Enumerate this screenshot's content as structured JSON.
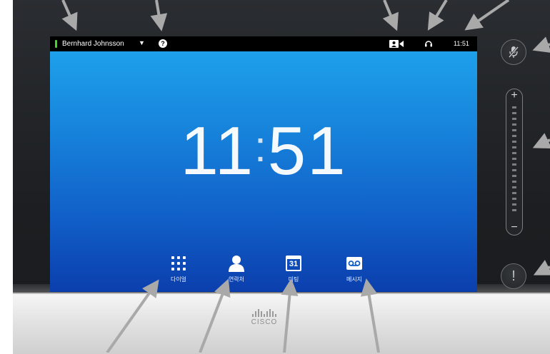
{
  "status_bar": {
    "user_name": "Bernhard Johnsson",
    "user_menu_caret": "▼",
    "help_symbol": "?",
    "time": "11:51",
    "presence_color": "#44d62c"
  },
  "clock": {
    "hours": "11",
    "separator": ":",
    "minutes": "51"
  },
  "apps": [
    {
      "label": "다이얼",
      "icon": "keypad-icon"
    },
    {
      "label": "연락처",
      "icon": "contact-person-icon"
    },
    {
      "label": "미팅",
      "icon": "calendar-icon",
      "calendar_day": "31"
    },
    {
      "label": "메시지",
      "icon": "voicemail-icon"
    }
  ],
  "side_controls": {
    "mute_icon": "microphone-mute-icon",
    "volume_plus": "+",
    "volume_minus": "−",
    "alert_symbol": "!"
  },
  "brand": {
    "logo_text": "CISCO"
  },
  "colors": {
    "screen_top": "#1fa6ee",
    "screen_bottom": "#0b3fad",
    "callout_arrow": "#a9a9a9"
  }
}
